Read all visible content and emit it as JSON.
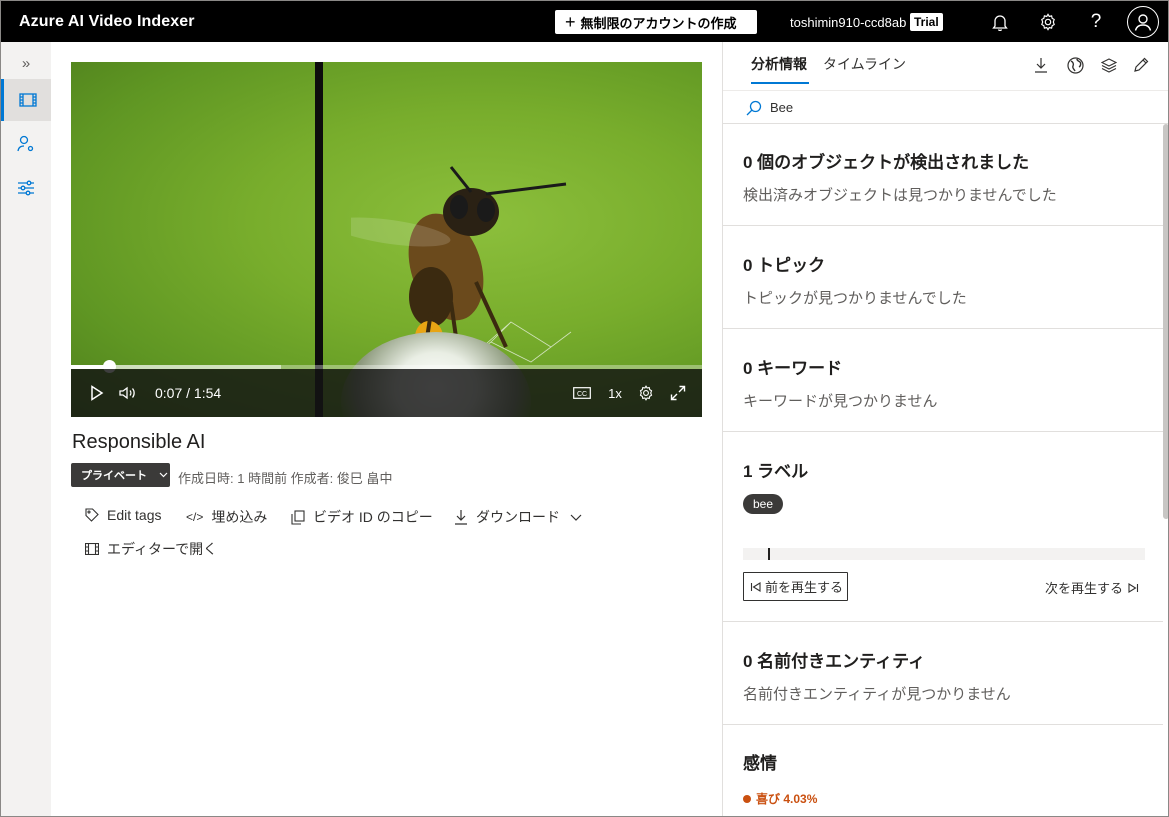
{
  "header": {
    "app_title": "Azure AI Video Indexer",
    "create_account_label": "無制限のアカウントの作成",
    "account_name": "toshimin910-ccd8ab",
    "trial_badge": "Trial"
  },
  "video": {
    "time_display": "0:07 / 1:54",
    "speed": "1x",
    "progress_fraction": 0.06,
    "title": "Responsible AI",
    "privacy_label": "プライベート",
    "meta": "作成日時: 1 時間前 作成者: 俊巳 畠中"
  },
  "actions": {
    "edit_tags": "Edit tags",
    "embed": "埋め込み",
    "copy_id": "ビデオ ID のコピー",
    "download": "ダウンロード",
    "open_editor": "エディターで開く"
  },
  "panel": {
    "tabs": [
      {
        "label": "分析情報"
      },
      {
        "label": "タイムライン"
      }
    ],
    "search_value": "Bee",
    "objects": {
      "title": "0 個のオブジェクトが検出されました",
      "desc": "検出済みオブジェクトは見つかりませんでした"
    },
    "topics": {
      "title": "0 トピック",
      "desc": "トピックが見つかりませんでした"
    },
    "keywords": {
      "title": "0 キーワード",
      "desc": "キーワードが見つかりません"
    },
    "labels": {
      "title": "1 ラベル",
      "chip": "bee",
      "prev_label": "前を再生する",
      "next_label": "次を再生する"
    },
    "entities": {
      "title": "0 名前付きエンティティ",
      "desc": "名前付きエンティティが見つかりません"
    },
    "emotion": {
      "title": "感情",
      "item": "喜び 4.03%",
      "color": "#ca5010"
    }
  }
}
